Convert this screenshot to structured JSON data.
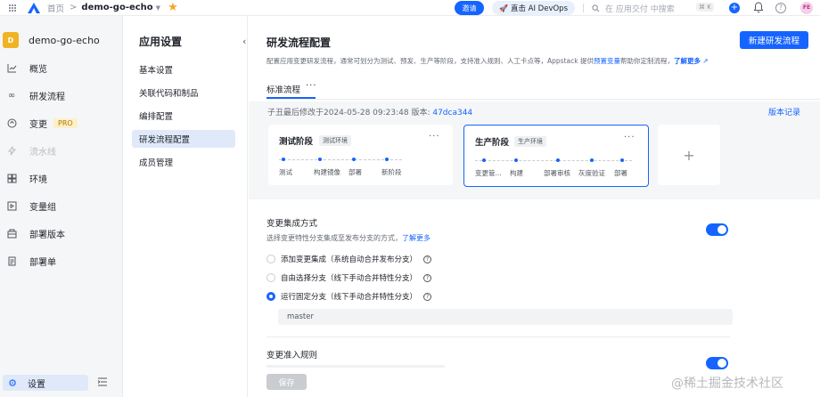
{
  "topbar": {
    "home": "首页",
    "sep": ">",
    "project": "demo-go-echo",
    "invite": "邀请",
    "ai": "直击 AI DevOps",
    "search_placeholder": "在 应用交付 中搜索",
    "shortcut": "⌘ K",
    "avatar": "FE"
  },
  "sidebar": {
    "project_initial": "D",
    "project_name": "demo-go-echo",
    "items": [
      {
        "label": "概览",
        "icon": "chart-icon"
      },
      {
        "label": "研发流程",
        "icon": "infinity-icon"
      },
      {
        "label": "变更",
        "icon": "change-icon",
        "badge": "PRO"
      },
      {
        "label": "流水线",
        "icon": "pipeline-icon"
      },
      {
        "label": "环境",
        "icon": "environment-icon"
      },
      {
        "label": "变量组",
        "icon": "variable-icon"
      },
      {
        "label": "部署版本",
        "icon": "package-icon"
      },
      {
        "label": "部署单",
        "icon": "deploy-doc-icon"
      }
    ],
    "settings": "设置"
  },
  "subnav": {
    "title": "应用设置",
    "items": [
      "基本设置",
      "关联代码和制品",
      "编排配置",
      "研发流程配置",
      "成员管理"
    ]
  },
  "main": {
    "title": "研发流程配置",
    "new_button": "新建研发流程",
    "desc_prefix": "配置应用变更研发流程，通常可划分为测试、预发、生产等阶段，支持准入规则、人工卡点等，Appstack 提供",
    "desc_link1": "预置变量",
    "desc_middle": "帮助你定制流程，",
    "desc_link2": "了解更多",
    "tab": "标准流程",
    "tab_more": "···",
    "meta_prefix": "子丑最后修改于2024-05-28 09:23:48   版本: ",
    "meta_hash": "47dca344",
    "version_log": "版本记录",
    "stages": [
      {
        "title": "测试阶段",
        "env": "测试环境",
        "steps": [
          "测试",
          "构建镜像",
          "部署",
          "新阶段"
        ]
      },
      {
        "title": "生产阶段",
        "env": "生产环境",
        "steps": [
          "变更管...",
          "构建",
          "部署审核",
          "灰度验证",
          "部署"
        ]
      }
    ],
    "add": "+",
    "merge_section": {
      "title": "变更集成方式",
      "desc": "选择变更特性分支集成至发布分支的方式，",
      "desc_link": "了解更多",
      "options": [
        "添加变更集成（系统自动合并发布分支）",
        "自由选择分支（线下手动合并特性分支）",
        "运行固定分支（线下手动合并特性分支）"
      ],
      "selected_index": 2,
      "branch": "master"
    },
    "rules_section": {
      "title": "变更准入规则"
    },
    "save": "保存"
  },
  "watermark": "@稀土掘金技术社区",
  "colors": {
    "accent": "#1664ff",
    "badge_bg": "#fdf0c7",
    "project_avatar": "#f0b323"
  }
}
